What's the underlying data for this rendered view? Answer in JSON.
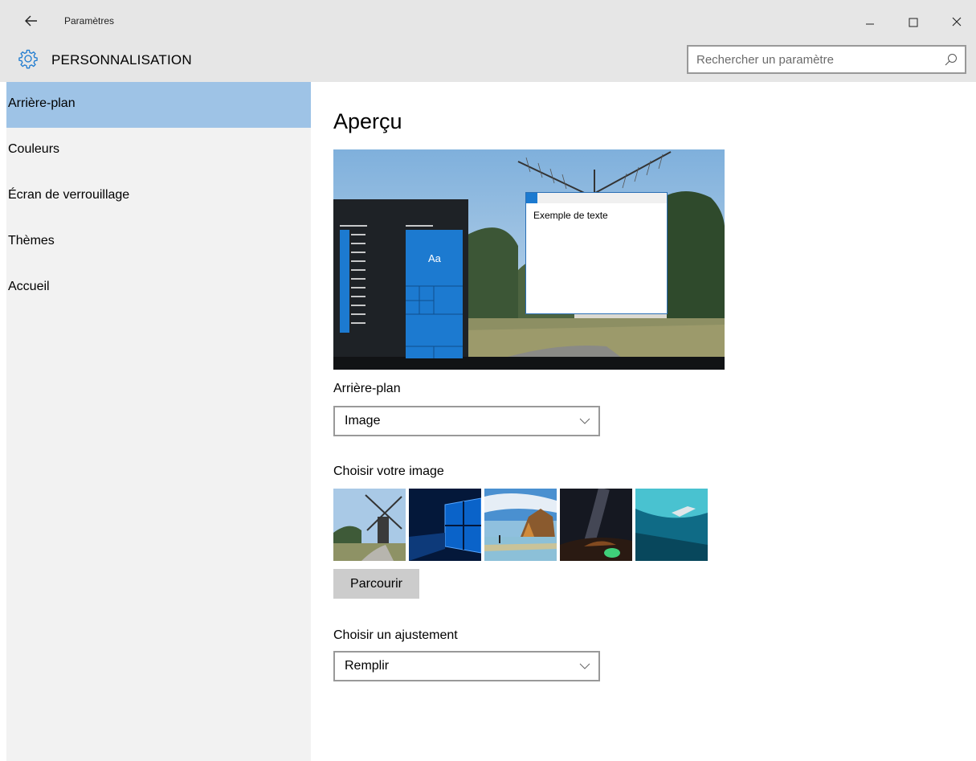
{
  "window": {
    "title": "Paramètres"
  },
  "header": {
    "section_title": "PERSONNALISATION",
    "search_placeholder": "Rechercher un paramètre"
  },
  "sidebar": {
    "items": [
      {
        "label": "Arrière-plan",
        "active": true
      },
      {
        "label": "Couleurs",
        "active": false
      },
      {
        "label": "Écran de verrouillage",
        "active": false
      },
      {
        "label": "Thèmes",
        "active": false
      },
      {
        "label": "Accueil",
        "active": false
      }
    ]
  },
  "main": {
    "preview_heading": "Aperçu",
    "preview": {
      "sample_text": "Exemple de texte",
      "tile_text": "Aa"
    },
    "background": {
      "label": "Arrière-plan",
      "value": "Image"
    },
    "choose_image": {
      "label": "Choisir votre image",
      "thumbnails": [
        "windmill",
        "windows-logo",
        "beach-rocks",
        "milky-way",
        "underwater-swimmer"
      ]
    },
    "browse_label": "Parcourir",
    "fit": {
      "label": "Choisir un ajustement",
      "value": "Remplir"
    }
  },
  "colors": {
    "accent": "#1c7ad0",
    "active_nav": "#9ec3e6",
    "sidebar_bg": "#f2f2f2",
    "titlebar_bg": "#e6e6e6"
  }
}
